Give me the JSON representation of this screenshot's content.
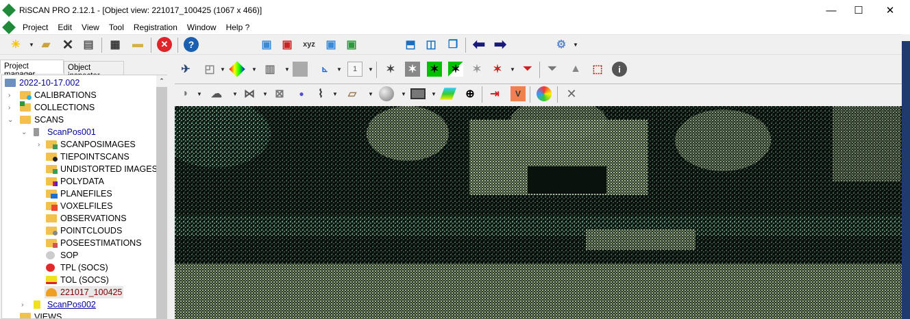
{
  "window": {
    "title": "RiSCAN PRO 2.12.1 - [Object view: 221017_100425 (1067 x 466)]",
    "minimize": "—",
    "maximize": "☐",
    "close": "✕"
  },
  "menu": [
    "Project",
    "Edit",
    "View",
    "Tool",
    "Registration",
    "Window",
    "Help ?"
  ],
  "mdi": {
    "minimize": "▁",
    "restore": "⧉",
    "close": "✕"
  },
  "tabs": [
    "Project manager",
    "Object inspector"
  ],
  "tree": {
    "root": "2022-10-17.002",
    "items": [
      "CALIBRATIONS",
      "COLLECTIONS",
      "SCANS"
    ],
    "scanpos1": "ScanPos001",
    "children": [
      "SCANPOSIMAGES",
      "TIEPOINTSCANS",
      "UNDISTORTED IMAGES",
      "POLYDATA",
      "PLANEFILES",
      "VOXELFILES",
      "OBSERVATIONS",
      "POINTCLOUDS",
      "POSEESTIMATIONS",
      "SOP",
      "TPL (SOCS)",
      "TOL (SOCS)",
      "221017_100425"
    ],
    "scanpos2": "ScanPos002",
    "views": "VIEWS"
  },
  "toolbar": {
    "layer_number": "1",
    "axis_label": "xyz"
  },
  "colors": {
    "accent": "#1e8a3a",
    "selected_text": "#800000",
    "link": "#0000a0"
  }
}
